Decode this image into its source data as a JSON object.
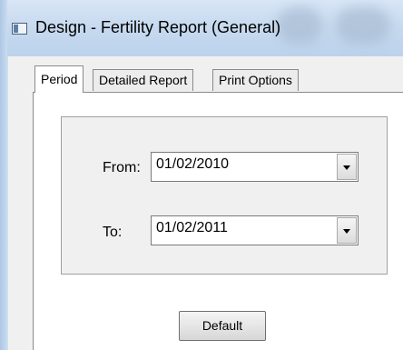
{
  "window": {
    "title": "Design - Fertility Report (General)"
  },
  "tabs": [
    {
      "label": "Period",
      "active": true
    },
    {
      "label": "Detailed Report",
      "active": false
    },
    {
      "label": "Print Options",
      "active": false
    }
  ],
  "period": {
    "from_label": "From:",
    "from_value": "01/02/2010",
    "to_label": "To:",
    "to_value": "01/02/2011"
  },
  "buttons": {
    "default_label": "Default"
  },
  "icons": {
    "window_icon": "window-icon",
    "dropdown_icon": "chevron-down-icon"
  }
}
